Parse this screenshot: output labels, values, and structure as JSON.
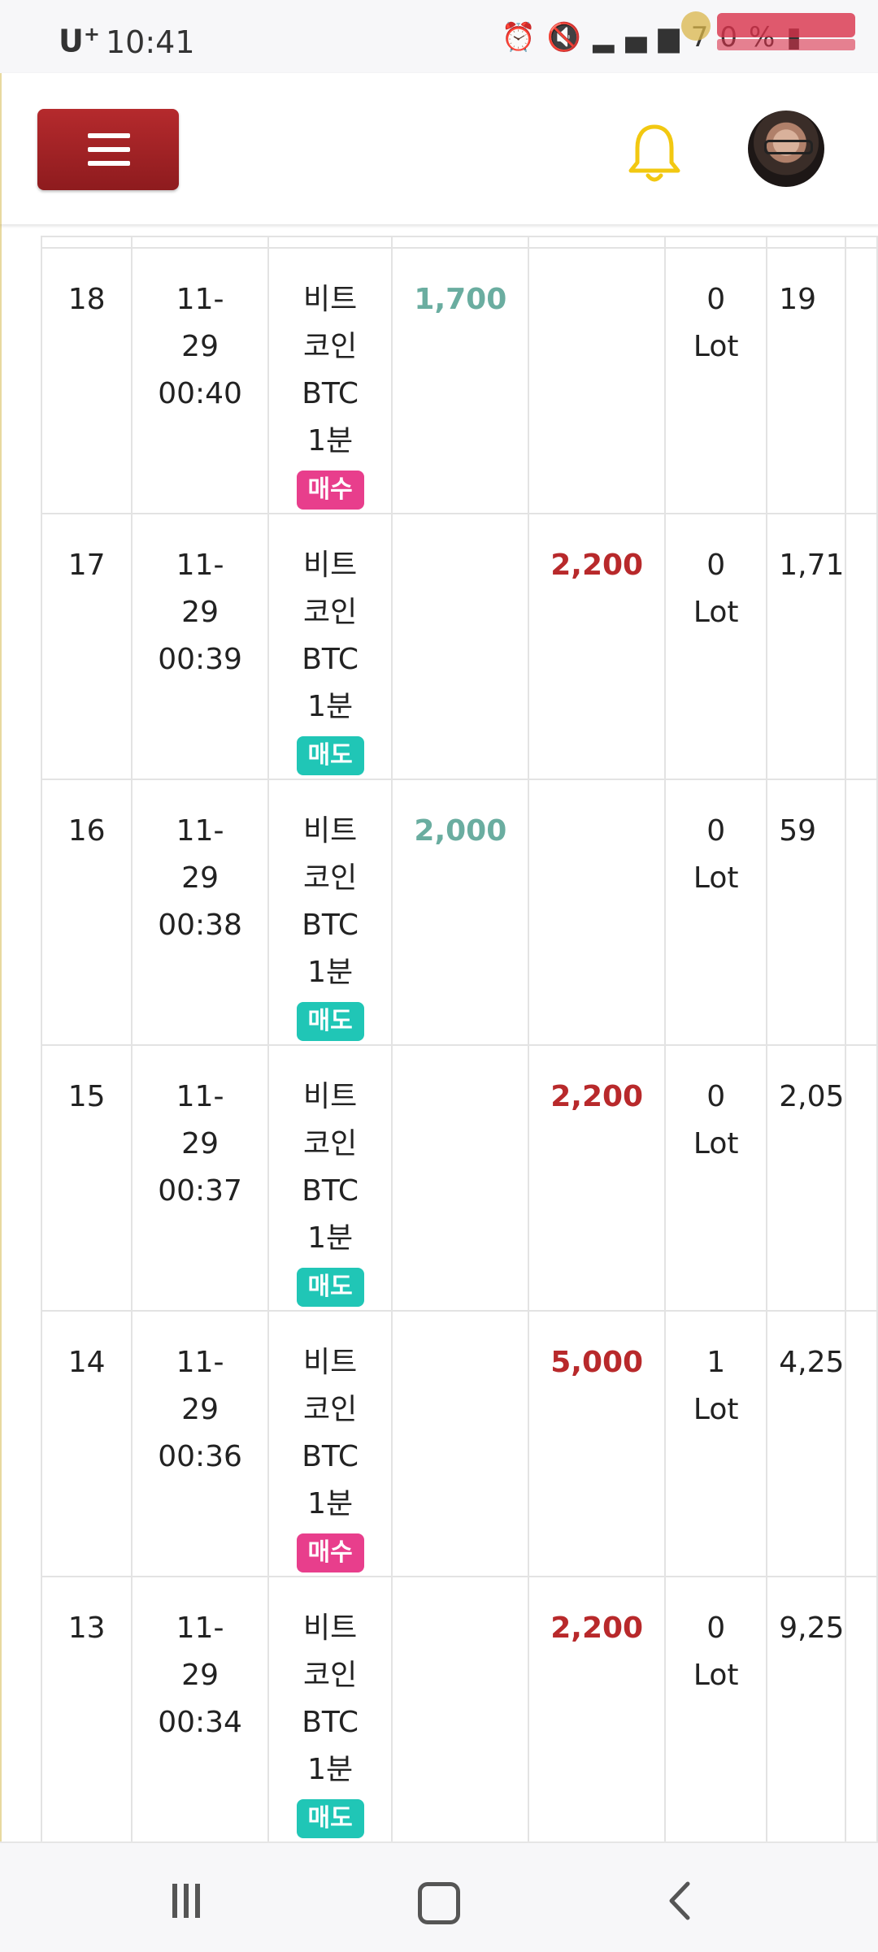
{
  "status_bar": {
    "carrier": "U",
    "carrier_plus": "+",
    "time": "10:41",
    "icons": [
      "alarm-icon",
      "mute-icon",
      "lte-signal-icon",
      "battery-icon"
    ],
    "battery": "70%"
  },
  "header": {
    "menu_icon": "hamburger-icon",
    "notification_icon": "bell-icon",
    "accent_color": "#a52426",
    "bell_color": "#f2c811"
  },
  "table": {
    "rows": [
      {
        "no": "18",
        "date": "11-",
        "date2": "29",
        "time": "00:40",
        "item1": "비트",
        "item2": "코인",
        "item3": "BTC",
        "item4": "1분",
        "side": "매수",
        "side_type": "buy",
        "buy": "1,700",
        "sell": "",
        "lot": "0",
        "lot_unit": "Lot",
        "pnl": "19"
      },
      {
        "no": "17",
        "date": "11-",
        "date2": "29",
        "time": "00:39",
        "item1": "비트",
        "item2": "코인",
        "item3": "BTC",
        "item4": "1분",
        "side": "매도",
        "side_type": "sell",
        "buy": "",
        "sell": "2,200",
        "lot": "0",
        "lot_unit": "Lot",
        "pnl": "1,71"
      },
      {
        "no": "16",
        "date": "11-",
        "date2": "29",
        "time": "00:38",
        "item1": "비트",
        "item2": "코인",
        "item3": "BTC",
        "item4": "1분",
        "side": "매도",
        "side_type": "sell",
        "buy": "2,000",
        "sell": "",
        "lot": "0",
        "lot_unit": "Lot",
        "pnl": "59"
      },
      {
        "no": "15",
        "date": "11-",
        "date2": "29",
        "time": "00:37",
        "item1": "비트",
        "item2": "코인",
        "item3": "BTC",
        "item4": "1분",
        "side": "매도",
        "side_type": "sell",
        "buy": "",
        "sell": "2,200",
        "lot": "0",
        "lot_unit": "Lot",
        "pnl": "2,05"
      },
      {
        "no": "14",
        "date": "11-",
        "date2": "29",
        "time": "00:36",
        "item1": "비트",
        "item2": "코인",
        "item3": "BTC",
        "item4": "1분",
        "side": "매수",
        "side_type": "buy",
        "buy": "",
        "sell": "5,000",
        "lot": "1",
        "lot_unit": "Lot",
        "pnl": "4,25"
      },
      {
        "no": "13",
        "date": "11-",
        "date2": "29",
        "time": "00:34",
        "item1": "비트",
        "item2": "코인",
        "item3": "BTC",
        "item4": "1분",
        "side": "매도",
        "side_type": "sell",
        "buy": "",
        "sell": "2,200",
        "lot": "0",
        "lot_unit": "Lot",
        "pnl": "9,25"
      }
    ],
    "buy_color": "#6aada0",
    "sell_color": "#b8292b",
    "badge_buy_color": "#e83e8c",
    "badge_sell_color": "#20c6b6"
  },
  "nav_bar": {
    "recents_icon": "recents-icon",
    "home_icon": "home-icon",
    "back_icon": "back-icon"
  }
}
